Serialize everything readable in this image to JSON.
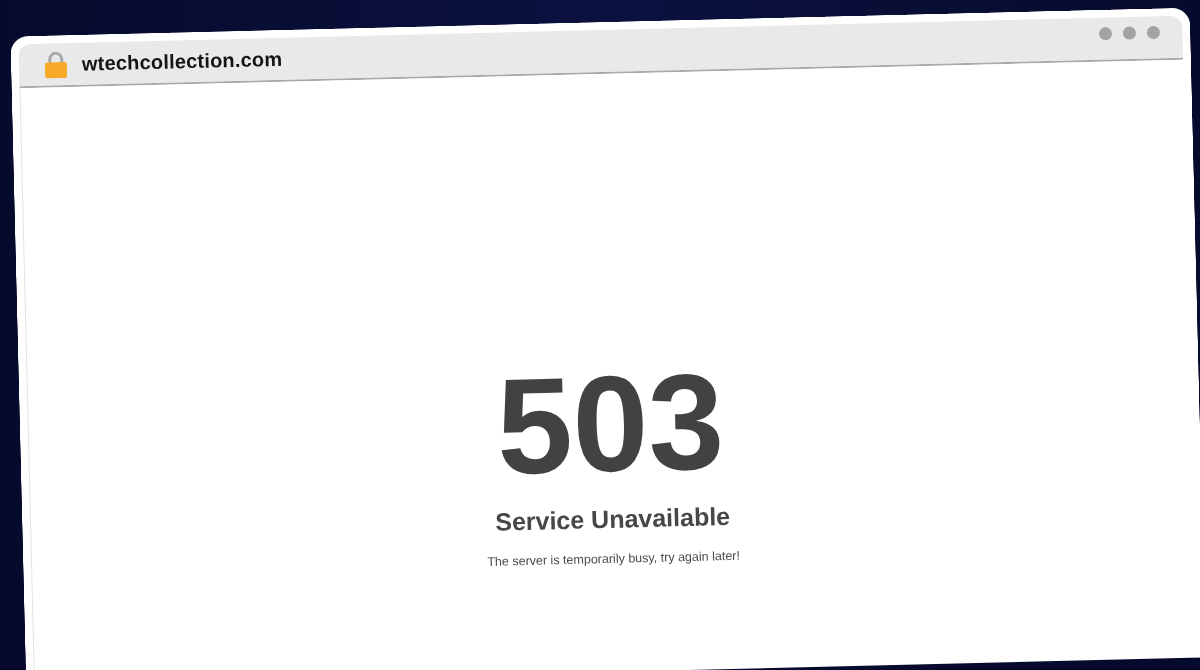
{
  "browser": {
    "address": "wtechcollection.com",
    "secure": true
  },
  "page": {
    "code": "503",
    "title": "Service Unavailable",
    "message": "The server is temporarily busy, try again later!"
  }
}
